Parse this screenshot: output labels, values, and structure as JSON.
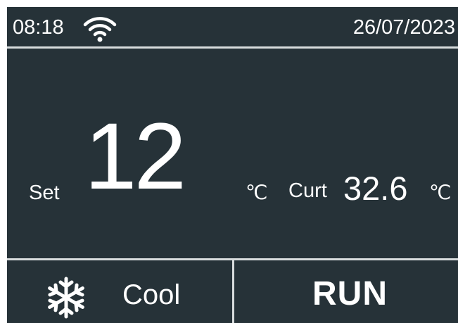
{
  "status_bar": {
    "time": "08:18",
    "wifi_icon": "wifi-icon",
    "date": "26/07/2023"
  },
  "main": {
    "set_label": "Set",
    "set_temperature": "12",
    "set_unit": "℃",
    "current_label": "Curt",
    "current_temperature": "32.6",
    "current_unit": "℃"
  },
  "bottom_bar": {
    "mode_icon": "snowflake-icon",
    "mode_label": "Cool",
    "run_label": "RUN"
  },
  "colors": {
    "background": "#263238",
    "text": "#ffffff",
    "divider": "#d8dcdd"
  }
}
